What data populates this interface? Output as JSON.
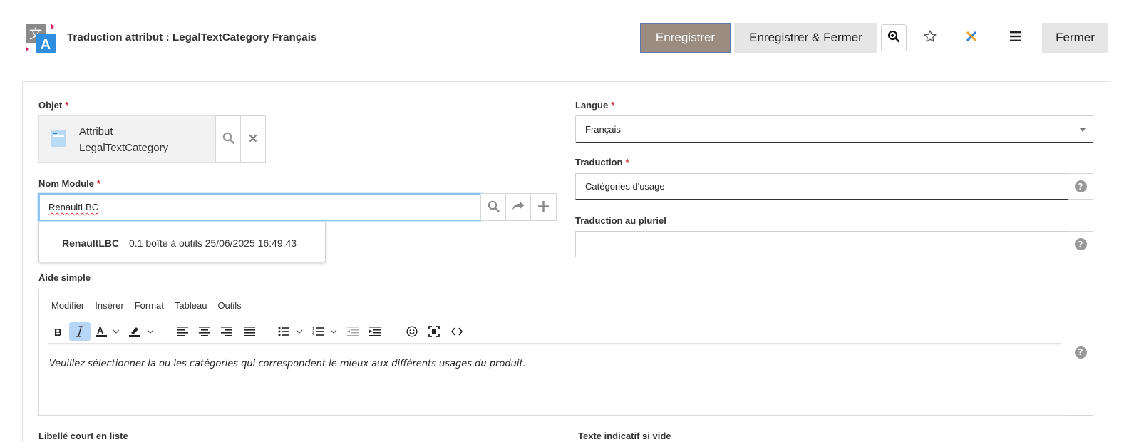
{
  "header": {
    "title": "Traduction attribut : LegalTextCategory Français",
    "save_label": "Enregistrer",
    "save_close_label": "Enregistrer & Fermer",
    "close_label": "Fermer"
  },
  "form": {
    "objet": {
      "label": "Objet",
      "required": "*",
      "value_line1": "Attribut",
      "value_line2": "LegalTextCategory"
    },
    "module": {
      "label": "Nom Module",
      "required": "*",
      "value": "RenaultLBC",
      "suggestion": {
        "name": "RenaultLBC",
        "meta": "0.1 boîte à outils 25/06/2025 16:49:43"
      }
    },
    "langue": {
      "label": "Langue",
      "required": "*",
      "value": "Français"
    },
    "traduction": {
      "label": "Traduction",
      "required": "*",
      "value": "Catégories d'usage"
    },
    "traduction_pluriel": {
      "label": "Traduction au pluriel",
      "value": ""
    },
    "aide": {
      "label": "Aide simple",
      "menu": [
        "Modifier",
        "Insérer",
        "Format",
        "Tableau",
        "Outils"
      ],
      "content": "Veuillez sélectionner la ou les catégories qui correspondent le mieux aux différents usages du produit."
    },
    "libelle_court": {
      "label": "Libellé court en liste"
    },
    "texte_indicatif": {
      "label": "Texte indicatif si vide"
    }
  },
  "colors": {
    "save_button": "#9a8c80",
    "secondary_button": "#e6e6e6",
    "required": "#d03030",
    "focus": "#8ec3ef"
  },
  "icons": {
    "app": "translate-icon",
    "zoom": "zoom-icon",
    "star": "star-icon",
    "tool": "tools-icon",
    "menu": "hamburger-icon"
  }
}
